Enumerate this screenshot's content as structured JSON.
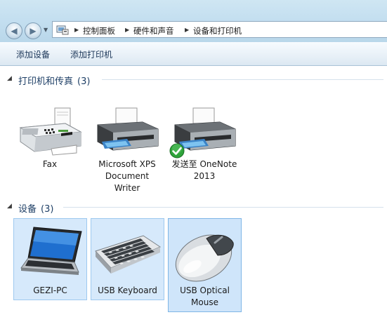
{
  "breadcrumb": [
    {
      "label": "控制面板"
    },
    {
      "label": "硬件和声音"
    },
    {
      "label": "设备和打印机"
    }
  ],
  "commands": {
    "add_device": "添加设备",
    "add_printer": "添加打印机"
  },
  "groups": {
    "printers": {
      "title": "打印机和传真",
      "count": "(3)",
      "items": [
        {
          "label_lines": [
            "Fax"
          ],
          "icon": "fax-machine-icon"
        },
        {
          "label_lines": [
            "Microsoft XPS",
            "Document",
            "Writer"
          ],
          "icon": "printer-icon"
        },
        {
          "label_lines": [
            "发送至 OneNote",
            "2013"
          ],
          "icon": "printer-icon",
          "default_badge": "check-badge-icon"
        }
      ]
    },
    "devices": {
      "title": "设备",
      "count": "(3)",
      "items": [
        {
          "label_lines": [
            "GEZI-PC"
          ],
          "icon": "laptop-icon",
          "selected": true
        },
        {
          "label_lines": [
            "USB Keyboard"
          ],
          "icon": "keyboard-icon",
          "selected": true
        },
        {
          "label_lines": [
            "USB Optical",
            "Mouse"
          ],
          "icon": "mouse-icon",
          "selected": true
        }
      ]
    }
  },
  "colors": {
    "selection_fill": "#d6e9fb",
    "selection_border": "#9ec9ef",
    "group_title": "#1e3f66",
    "check_green": "#2ea33a"
  }
}
